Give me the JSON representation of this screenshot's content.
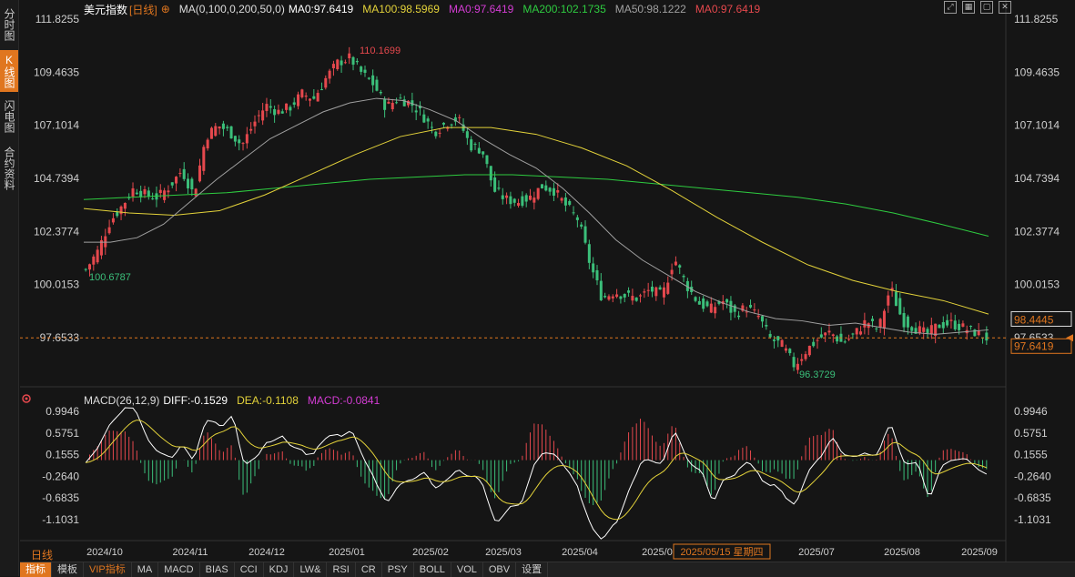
{
  "sidebar": {
    "tabs": [
      {
        "label": "分时图",
        "active": false
      },
      {
        "label": "K线图",
        "active": true
      },
      {
        "label": "闪电图",
        "active": false
      },
      {
        "label": "合约资料",
        "active": false
      }
    ]
  },
  "header": {
    "name": "美元指数",
    "period": "[日线]",
    "add_icon": "plus-circle-icon",
    "ma_params": "MA(0,100,0,200,50,0)",
    "ma_main": "MA0:97.6419",
    "ma100": "MA100:98.5969",
    "ma0_b": "MA0:97.6419",
    "ma200": "MA200:102.1735",
    "ma50": "MA50:98.1222",
    "ma0_c": "MA0:97.6419"
  },
  "window_buttons": [
    {
      "icon": "expand-icon"
    },
    {
      "icon": "grid-icon"
    },
    {
      "icon": "restore-icon"
    },
    {
      "icon": "close-icon"
    }
  ],
  "macd_header": {
    "params": "MACD(26,12,9)",
    "diff": "DIFF:-0.1529",
    "dea": "DEA:-0.1108",
    "macd": "MACD:-0.0841"
  },
  "price_axis": {
    "ticks": [
      "111.8255",
      "109.4635",
      "107.1014",
      "104.7394",
      "102.3774",
      "100.0153",
      "97.6533"
    ]
  },
  "macd_axis": {
    "ticks": [
      "0.9946",
      "0.5751",
      "0.1555",
      "-0.2640",
      "-0.6835",
      "-1.1031"
    ]
  },
  "markers": {
    "high": "110.1699",
    "low": "96.3729",
    "start": "100.6787"
  },
  "last_price_label": "98.4445",
  "current_price_label": "97.6419",
  "time_axis": {
    "labels": [
      "2024/10",
      "2024/11",
      "2024/12",
      "2025/01",
      "2025/02",
      "2025/03",
      "2025/04",
      "2025/0",
      "2025/07",
      "2025/08",
      "2025/09"
    ]
  },
  "crosshair_label": "2025/05/15 星期四",
  "period_selector": "日线",
  "bottom_tabs": [
    {
      "label": "指标",
      "active": true
    },
    {
      "label": "模板"
    },
    {
      "label": "VIP指标",
      "vip": true
    },
    {
      "label": "MA"
    },
    {
      "label": "MACD"
    },
    {
      "label": "BIAS"
    },
    {
      "label": "CCI"
    },
    {
      "label": "KDJ"
    },
    {
      "label": "LW&"
    },
    {
      "label": "RSI"
    },
    {
      "label": "CR"
    },
    {
      "label": "PSY"
    },
    {
      "label": "BOLL"
    },
    {
      "label": "VOL"
    },
    {
      "label": "OBV"
    },
    {
      "label": "设置"
    }
  ],
  "colors": {
    "up": "#e5484d",
    "down": "#3bbf7a",
    "ma50": "#a0a0a0",
    "ma100": "#e3d23a",
    "ma200": "#2ecc40",
    "diff": "#ffffff",
    "dea": "#e3d23a",
    "accent": "#e0761f"
  },
  "chart_data": {
    "type": "candlestick",
    "x_range": [
      "2024-09-27",
      "2025-09-12"
    ],
    "ylim": [
      96.0,
      111.8255
    ],
    "close_path": [
      100.68,
      101.5,
      102.8,
      103.5,
      104.3,
      104.0,
      103.9,
      104.4,
      105.1,
      104.0,
      106.6,
      107.1,
      106.8,
      106.2,
      107.2,
      108.0,
      107.7,
      107.9,
      108.5,
      108.3,
      109.2,
      109.9,
      110.1,
      109.4,
      108.9,
      107.9,
      108.3,
      108.1,
      107.6,
      106.8,
      107.2,
      107.4,
      106.2,
      106.0,
      104.2,
      103.8,
      103.7,
      103.9,
      104.4,
      104.2,
      103.5,
      102.9,
      100.9,
      99.4,
      99.7,
      99.5,
      99.4,
      99.8,
      99.5,
      101.2,
      100.0,
      99.2,
      98.9,
      99.3,
      98.7,
      99.0,
      98.6,
      97.6,
      97.3,
      96.4,
      97.1,
      97.6,
      97.9,
      97.4,
      97.8,
      98.4,
      98.0,
      99.9,
      98.4,
      98.1,
      97.8,
      98.2,
      98.3,
      98.1,
      97.9,
      97.64
    ],
    "ma50_path": [
      101.9,
      101.9,
      102.1,
      102.7,
      103.7,
      104.7,
      105.6,
      106.5,
      107.1,
      107.7,
      108.1,
      108.3,
      108.2,
      107.8,
      107.3,
      106.5,
      105.8,
      105.2,
      104.3,
      103.2,
      102.0,
      101.1,
      100.4,
      99.7,
      99.2,
      98.8,
      98.5,
      98.4,
      98.2,
      98.3,
      98.1,
      97.9,
      97.8,
      97.9,
      98.0
    ],
    "ma100_path": [
      103.4,
      103.2,
      103.1,
      103.3,
      104.0,
      104.9,
      105.8,
      106.6,
      107.0,
      107.0,
      106.7,
      106.1,
      105.3,
      104.2,
      103.0,
      101.9,
      100.9,
      100.2,
      99.7,
      99.3,
      98.7
    ],
    "ma200_path": [
      103.8,
      103.9,
      104.0,
      104.1,
      104.3,
      104.5,
      104.7,
      104.8,
      104.9,
      104.9,
      104.8,
      104.7,
      104.5,
      104.3,
      104.1,
      103.9,
      103.6,
      103.2,
      102.7,
      102.17
    ],
    "macd_series": [
      {
        "name": "DIFF",
        "value": -0.1529
      },
      {
        "name": "DEA",
        "value": -0.1108
      },
      {
        "name": "MACD",
        "value": -0.0841
      }
    ]
  }
}
